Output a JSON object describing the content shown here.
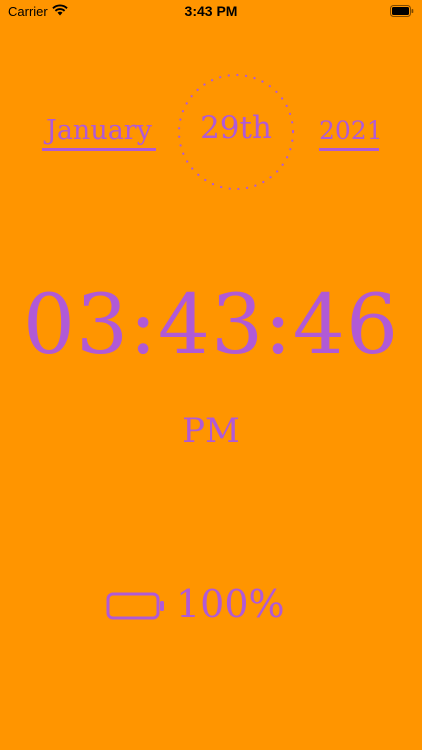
{
  "status_bar": {
    "carrier": "Carrier",
    "time": "3:43 PM"
  },
  "date": {
    "month": "January",
    "day": "29th",
    "year": "2021"
  },
  "clock": {
    "time": "03:43:46",
    "meridiem": "PM"
  },
  "battery": {
    "level_text": "100%",
    "level_fraction": 1.0
  },
  "colors": {
    "background": "#ff9500",
    "accent": "#b05ad6"
  },
  "icons": {
    "wifi": "wifi-icon",
    "status_battery": "battery-icon",
    "battery": "battery-outline-icon"
  }
}
